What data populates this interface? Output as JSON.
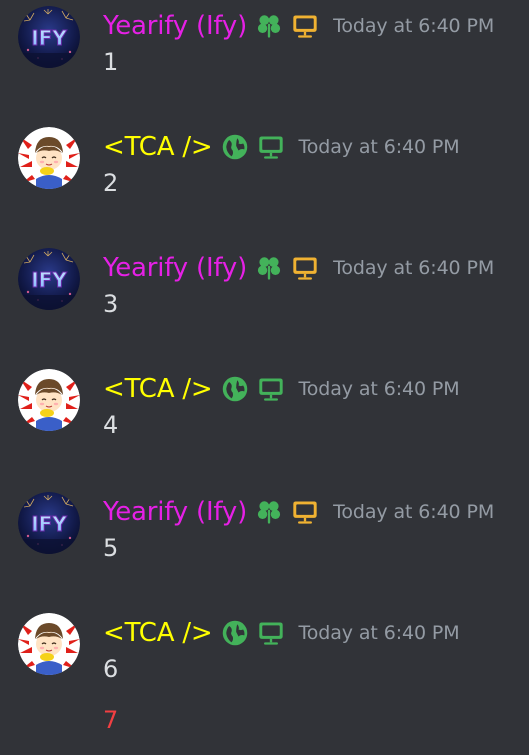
{
  "messages": [
    {
      "author": "Yearify (Ify)",
      "author_color": "#e620e6",
      "avatar_icon": "ify-fireworks-avatar",
      "badges": [
        "clover-icon",
        "desktop-icon"
      ],
      "badge_colors": [
        "#43b25a",
        "#f0b232"
      ],
      "timestamp": "Today at 6:40 PM",
      "content": "1"
    },
    {
      "author": "<TCA />",
      "author_color": "#ffff00",
      "avatar_icon": "anime-boy-arrows-avatar",
      "badges": [
        "globe-icon",
        "desktop-icon"
      ],
      "badge_colors": [
        "#43b25a",
        "#43b25a"
      ],
      "timestamp": "Today at 6:40 PM",
      "content": "2"
    },
    {
      "author": "Yearify (Ify)",
      "author_color": "#e620e6",
      "avatar_icon": "ify-fireworks-avatar",
      "badges": [
        "clover-icon",
        "desktop-icon"
      ],
      "badge_colors": [
        "#43b25a",
        "#f0b232"
      ],
      "timestamp": "Today at 6:40 PM",
      "content": "3"
    },
    {
      "author": "<TCA />",
      "author_color": "#ffff00",
      "avatar_icon": "anime-boy-arrows-avatar",
      "badges": [
        "globe-icon",
        "desktop-icon"
      ],
      "badge_colors": [
        "#43b25a",
        "#43b25a"
      ],
      "timestamp": "Today at 6:40 PM",
      "content": "4"
    },
    {
      "author": "Yearify (Ify)",
      "author_color": "#e620e6",
      "avatar_icon": "ify-fireworks-avatar",
      "badges": [
        "clover-icon",
        "desktop-icon"
      ],
      "badge_colors": [
        "#43b25a",
        "#f0b232"
      ],
      "timestamp": "Today at 6:40 PM",
      "content": "5"
    },
    {
      "author": "<TCA />",
      "author_color": "#ffff00",
      "avatar_icon": "anime-boy-arrows-avatar",
      "badges": [
        "globe-icon",
        "desktop-icon"
      ],
      "badge_colors": [
        "#43b25a",
        "#43b25a"
      ],
      "timestamp": "Today at 6:40 PM",
      "content": "6",
      "extra_line": "7",
      "extra_line_color": "#f23f42"
    }
  ]
}
